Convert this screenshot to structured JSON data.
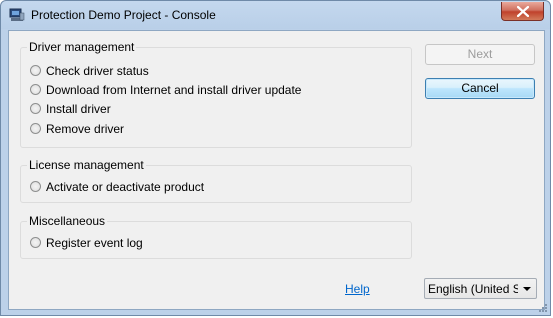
{
  "window": {
    "title": "Protection Demo Project - Console",
    "close_icon": "close-icon"
  },
  "groups": {
    "driver": {
      "title": "Driver management",
      "options": [
        {
          "label": "Check driver status"
        },
        {
          "label": "Download from Internet and install driver update"
        },
        {
          "label": "Install driver"
        },
        {
          "label": "Remove driver"
        }
      ]
    },
    "license": {
      "title": "License management",
      "options": [
        {
          "label": "Activate or deactivate product"
        }
      ]
    },
    "misc": {
      "title": "Miscellaneous",
      "options": [
        {
          "label": "Register event log"
        }
      ]
    }
  },
  "buttons": {
    "next_label": "Next",
    "next_enabled": false,
    "cancel_label": "Cancel"
  },
  "footer": {
    "help_label": "Help",
    "language_value": "English (United Sta"
  },
  "colors": {
    "frame": "#bcd1e9",
    "client": "#f0f0f0",
    "link": "#0066cc",
    "close": "#c0422c"
  }
}
